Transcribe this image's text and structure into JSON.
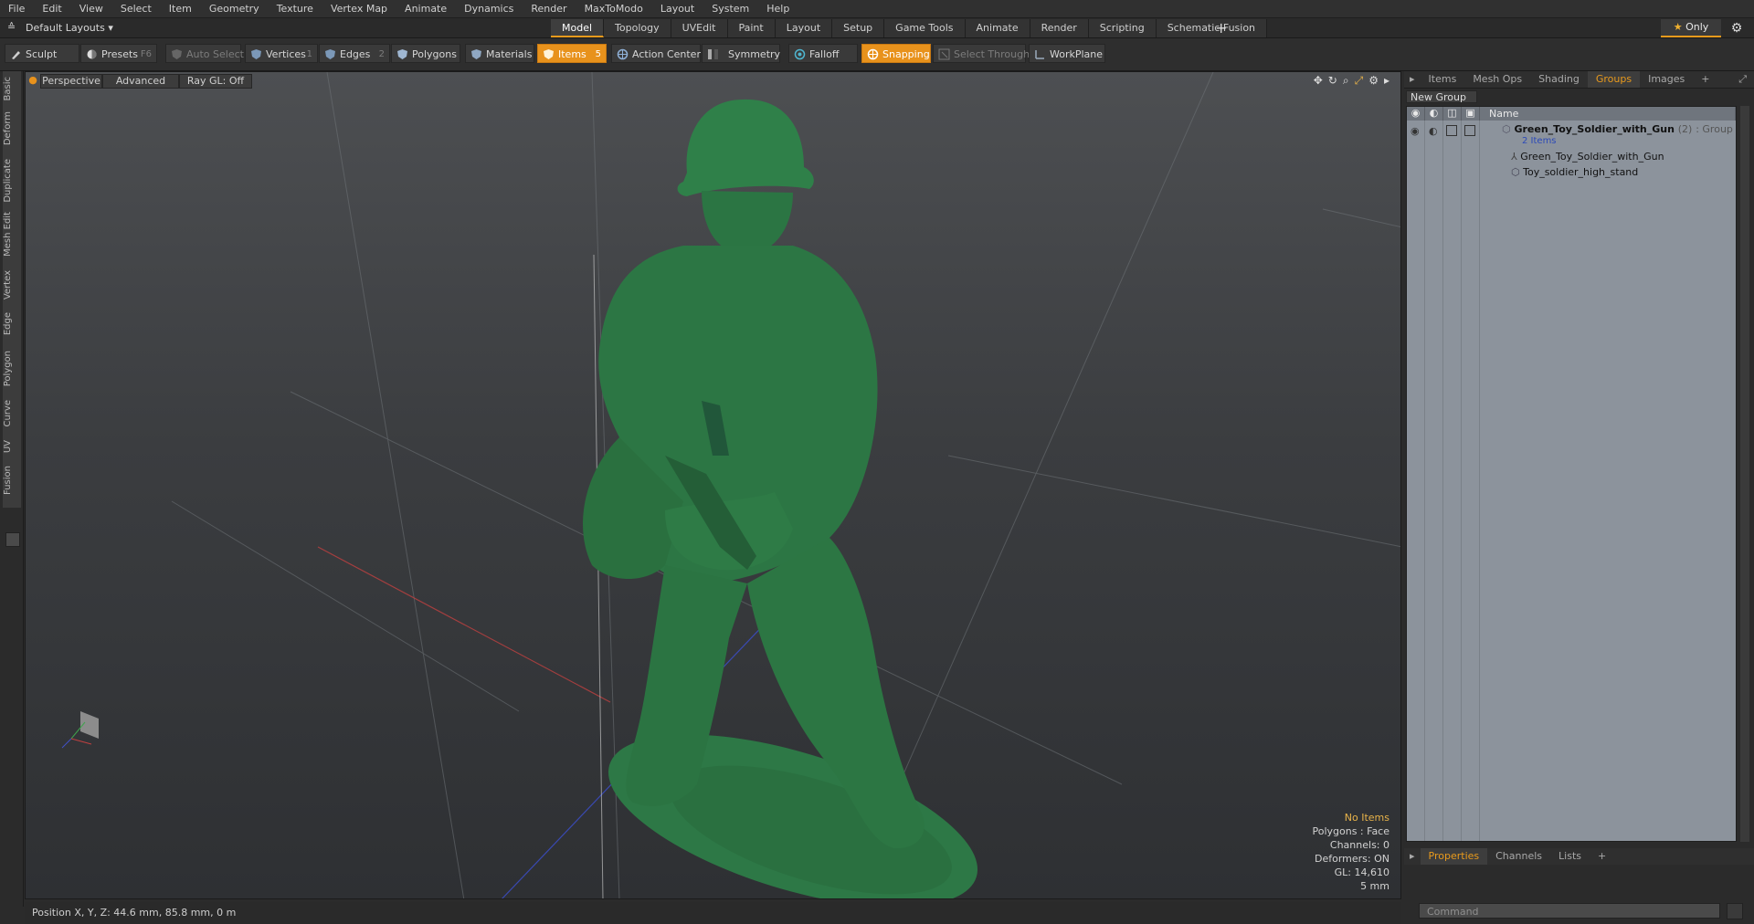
{
  "menu": [
    "File",
    "Edit",
    "View",
    "Select",
    "Item",
    "Geometry",
    "Texture",
    "Vertex Map",
    "Animate",
    "Dynamics",
    "Render",
    "MaxToModo",
    "Layout",
    "System",
    "Help"
  ],
  "layouts": {
    "dropdown": "Default Layouts",
    "tabs": [
      {
        "label": "Model",
        "active": true
      },
      {
        "label": "Topology"
      },
      {
        "label": "UVEdit"
      },
      {
        "label": "Paint"
      },
      {
        "label": "Layout"
      },
      {
        "label": "Setup"
      },
      {
        "label": "Game Tools"
      },
      {
        "label": "Animate"
      },
      {
        "label": "Render"
      },
      {
        "label": "Scripting"
      },
      {
        "label": "Schematic Fusion"
      }
    ],
    "plus": "+",
    "only": "Only"
  },
  "toolbar": {
    "sculpt": "Sculpt",
    "presets": "Presets",
    "presets_key": "F6",
    "auto_select": "Auto Select",
    "vertices": "Vertices",
    "vertices_key": "1",
    "edges": "Edges",
    "edges_key": "2",
    "polygons": "Polygons",
    "materials": "Materials",
    "items": "Items",
    "items_key": "5",
    "action_center": "Action Center",
    "symmetry": "Symmetry",
    "falloff": "Falloff",
    "snapping": "Snapping",
    "select_through": "Select Through",
    "workplane": "WorkPlane"
  },
  "leftstrip": [
    "Basic",
    "Deform",
    "Duplicate",
    "Mesh Edit",
    "Vertex",
    "Edge",
    "Polygon",
    "Curve",
    "UV",
    "Fusion"
  ],
  "viewport": {
    "view": "Perspective",
    "advanced": "Advanced",
    "raygl": "Ray GL: Off",
    "stats": {
      "no_items": "No Items",
      "polygons": "Polygons : Face",
      "channels": "Channels: 0",
      "deformers": "Deformers: ON",
      "gl": "GL: 14,610",
      "scale": "5 mm"
    }
  },
  "status": "Position X, Y, Z:   44.6 mm, 85.8 mm, 0 m",
  "right_panel": {
    "tabs": [
      {
        "label": "Items"
      },
      {
        "label": "Mesh Ops"
      },
      {
        "label": "Shading"
      },
      {
        "label": "Groups",
        "active": true
      },
      {
        "label": "Images"
      },
      {
        "label": "+"
      }
    ],
    "new_group": "New Group",
    "col_name": "Name",
    "group_name": "Green_Toy_Soldier_with_Gun",
    "group_count": "(2)",
    "group_type": ": Group",
    "group_items": "2 Items",
    "child1": "Green_Toy_Soldier_with_Gun",
    "child2": "Toy_soldier_high_stand",
    "bottom_tabs": [
      {
        "label": "Properties",
        "active": true
      },
      {
        "label": "Channels"
      },
      {
        "label": "Lists"
      },
      {
        "label": "+"
      }
    ],
    "command_placeholder": "Command"
  },
  "colors": {
    "accent": "#e8921c",
    "soldier": "#2e7a45"
  }
}
